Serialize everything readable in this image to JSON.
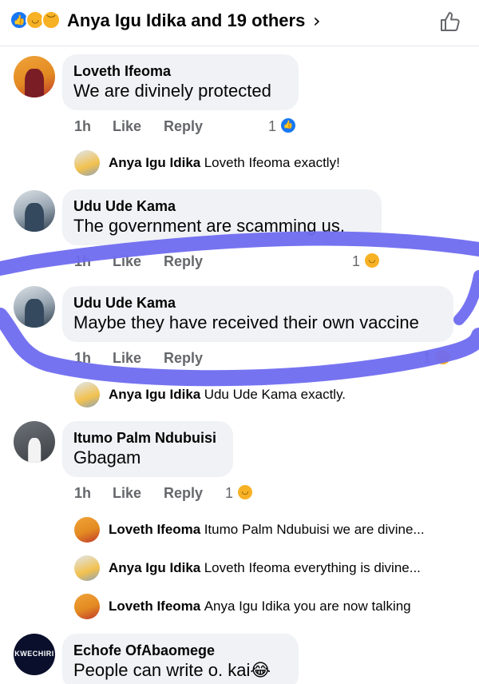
{
  "header": {
    "title": "Anya Igu Idika and 19 others",
    "reactions": [
      "like-reaction-icon",
      "haha-reaction-icon",
      "sad-reaction-icon"
    ],
    "chevron": "›"
  },
  "comments": [
    {
      "author": "Loveth Ifeoma",
      "text": "We are divinely protected",
      "time": "1h",
      "like": "Like",
      "reply": "Reply",
      "reaction_count": "1",
      "reaction_type": "like"
    },
    {
      "author": "Udu Ude Kama",
      "text": "The government are scamming us.",
      "time": "1h",
      "like": "Like",
      "reply": "Reply",
      "reaction_count": "1",
      "reaction_type": "haha"
    },
    {
      "author": "Udu Ude Kama",
      "text": "Maybe they have received their own vaccine",
      "time": "1h",
      "like": "Like",
      "reply": "Reply",
      "reaction_count": "1",
      "reaction_type": "haha"
    },
    {
      "author": "Itumo Palm Ndubuisi",
      "text": "Gbagam",
      "time": "1h",
      "like": "Like",
      "reply": "Reply",
      "reaction_count": "1",
      "reaction_type": "haha"
    },
    {
      "author": "Echofe OfAbaomege",
      "text": "People can write o. kai😂"
    }
  ],
  "replies": [
    {
      "author": "Anya Igu Idika",
      "text": "Loveth Ifeoma exactly!"
    },
    {
      "author": "Anya Igu Idika",
      "text": "Udu Ude Kama exactly."
    },
    {
      "author": "Loveth Ifeoma",
      "text": "Itumo Palm Ndubuisi we are divine..."
    },
    {
      "author": "Anya Igu Idika",
      "text": "Loveth Ifeoma everything is divine..."
    },
    {
      "author": "Loveth Ifeoma",
      "text": "Anya Igu Idika you are now talking"
    }
  ],
  "avatars": {
    "kwechiri_logo": "KWECHIRI"
  },
  "colors": {
    "bubble_bg": "#f0f2f5",
    "meta_text": "#65676b",
    "like_blue": "#1877f2",
    "haha_yellow": "#f7b125",
    "highlight_stroke": "#6f6cf0"
  }
}
